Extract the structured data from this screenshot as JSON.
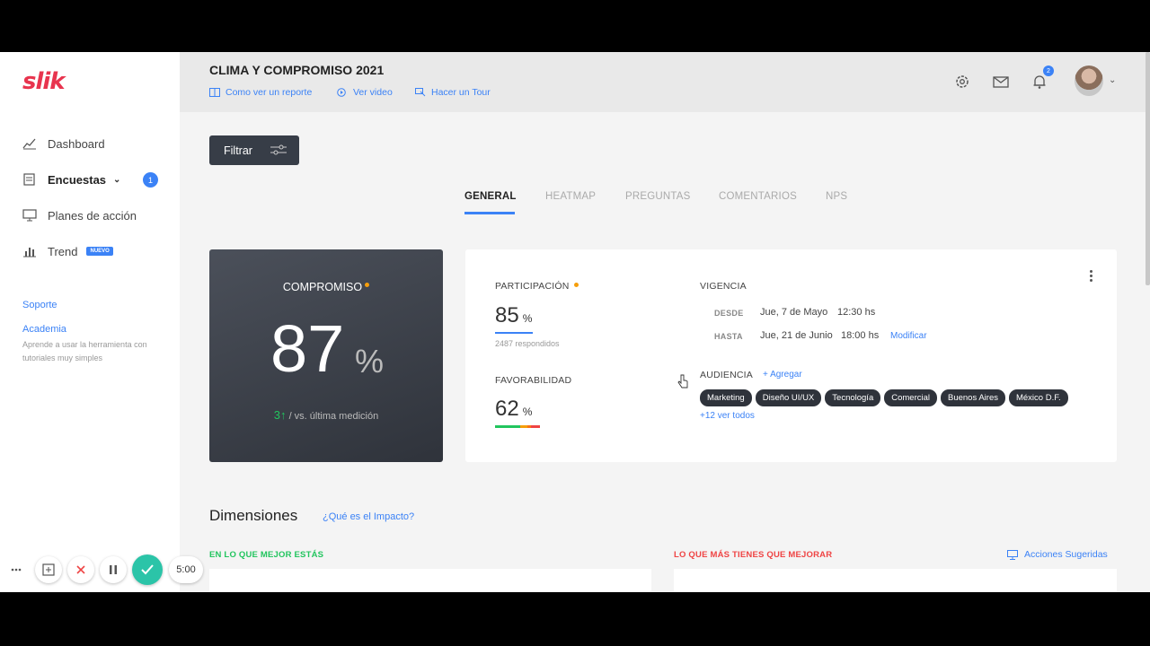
{
  "app": {
    "logo": "slik"
  },
  "sidebar": {
    "items": [
      {
        "label": "Dashboard",
        "icon": "chart-line-icon"
      },
      {
        "label": "Encuestas",
        "icon": "survey-list-icon",
        "badge": "1"
      },
      {
        "label": "Planes de acción",
        "icon": "monitor-icon"
      },
      {
        "label": "Trend",
        "icon": "bar-chart-icon",
        "badge": "NUEVO"
      }
    ],
    "support": "Soporte",
    "academy": "Academia",
    "academy_desc": "Aprende a usar la herramienta con tutoriales muy simples"
  },
  "header": {
    "title": "CLIMA Y COMPROMISO 2021",
    "links": [
      "Como ver un reporte",
      "Ver video",
      "Hacer un Tour"
    ],
    "notification_count": "2"
  },
  "filter": {
    "label": "Filtrar"
  },
  "tabs": [
    "GENERAL",
    "HEATMAP",
    "PREGUNTAS",
    "COMENTARIOS",
    "NPS"
  ],
  "commitment": {
    "label": "COMPROMISO",
    "value": "87",
    "unit": "%",
    "delta": "3",
    "delta_text": "/ vs. última medición"
  },
  "participation": {
    "label": "PARTICIPACIÓN",
    "value": "85",
    "unit": "%",
    "respondents": "2487 respondidos"
  },
  "favorability": {
    "label": "FAVORABILIDAD",
    "value": "62",
    "unit": "%"
  },
  "validity": {
    "label": "VIGENCIA",
    "from_label": "DESDE",
    "from_date": "Jue, 7 de Mayo",
    "from_time": "12:30 hs",
    "to_label": "HASTA",
    "to_date": "Jue, 21 de Junio",
    "to_time": "18:00 hs",
    "modify": "Modificar"
  },
  "audience": {
    "label": "AUDIENCIA",
    "add": "+ Agregar",
    "chips": [
      "Marketing",
      "Diseño UI/UX",
      "Tecnología",
      "Comercial",
      "Buenos Aires",
      "México D.F."
    ],
    "more": "+12 ver todos"
  },
  "dimensions": {
    "title": "Dimensiones",
    "link": "¿Qué es el Impacto?",
    "best": "EN LO QUE MEJOR ESTÁS",
    "worst": "LO QUE MÁS TIENES QUE MEJORAR",
    "suggested": "Acciones Sugeridas"
  },
  "recorder": {
    "time": "5:00"
  },
  "colors": {
    "accent": "#3b82f6",
    "brand": "#e8344e",
    "dark_card": "#373d47",
    "positive": "#22c55e",
    "negative": "#ef4444",
    "warning": "#f59e0b"
  }
}
